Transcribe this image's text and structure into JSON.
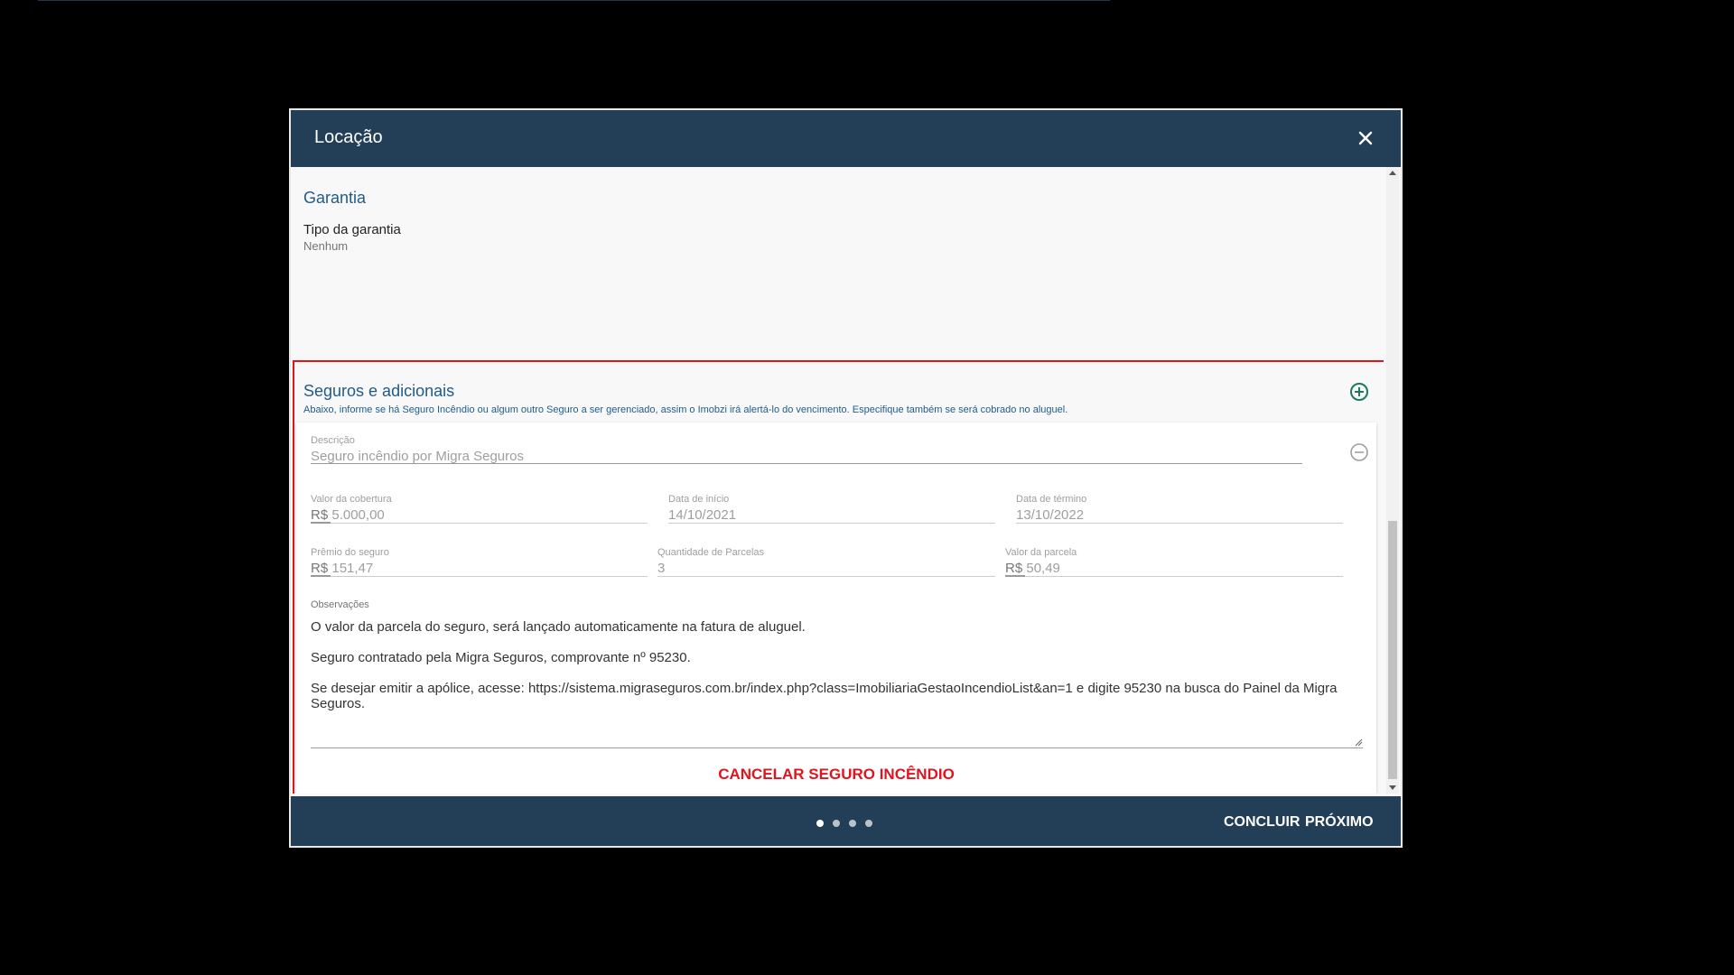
{
  "dialog": {
    "title": "Locação",
    "close_icon": "close-icon"
  },
  "garantia": {
    "title": "Garantia",
    "tipo_label": "Tipo da garantia",
    "tipo_value": "Nenhum"
  },
  "seguros": {
    "title": "Seguros e adicionais",
    "description": "Abaixo, informe se há Seguro Incêndio ou algum outro Seguro a ser gerenciado, assim o Imobzi irá alertá-lo do vencimento. Especifique também se será cobrado no aluguel.",
    "add_icon": "plus-circle-icon",
    "item": {
      "remove_icon": "minus-circle-icon",
      "descricao": {
        "label": "Descrição",
        "value": "Seguro incêndio por Migra Seguros"
      },
      "valor_cobertura": {
        "label": "Valor da cobertura",
        "prefix": "R$",
        "value": "5.000,00"
      },
      "data_inicio": {
        "label": "Data de início",
        "value": "14/10/2021"
      },
      "data_termino": {
        "label": "Data de término",
        "value": "13/10/2022"
      },
      "premio": {
        "label": "Prêmio do seguro",
        "prefix": "R$",
        "value": "151,47"
      },
      "quantidade_parcelas": {
        "label": "Quantidade de Parcelas",
        "value": "3"
      },
      "valor_parcela": {
        "label": "Valor da parcela",
        "prefix": "R$",
        "value": "50,49"
      },
      "observacoes": {
        "label": "Observações",
        "lines": [
          "O valor da parcela do seguro, será lançado automaticamente na fatura de aluguel.",
          "Seguro contratado pela Migra Seguros, comprovante nº 95230.",
          "Se desejar emitir a apólice, acesse: https://sistema.migraseguros.com.br/index.php?class=ImobiliariaGestaoIncendioList&an=1 e digite 95230 na busca do Painel da Migra Seguros."
        ]
      },
      "cancel_label": "CANCELAR SEGURO INCÊNDIO"
    }
  },
  "footer": {
    "steps_total": 4,
    "current_step": 1,
    "concluir_label": "CONCLUIR",
    "proximo_label": "PRÓXIMO"
  },
  "colors": {
    "header_bg": "#233f57",
    "accent_blue": "#1f5b8c",
    "highlight_red": "#e0141e",
    "add_green": "#1a7a5a"
  }
}
